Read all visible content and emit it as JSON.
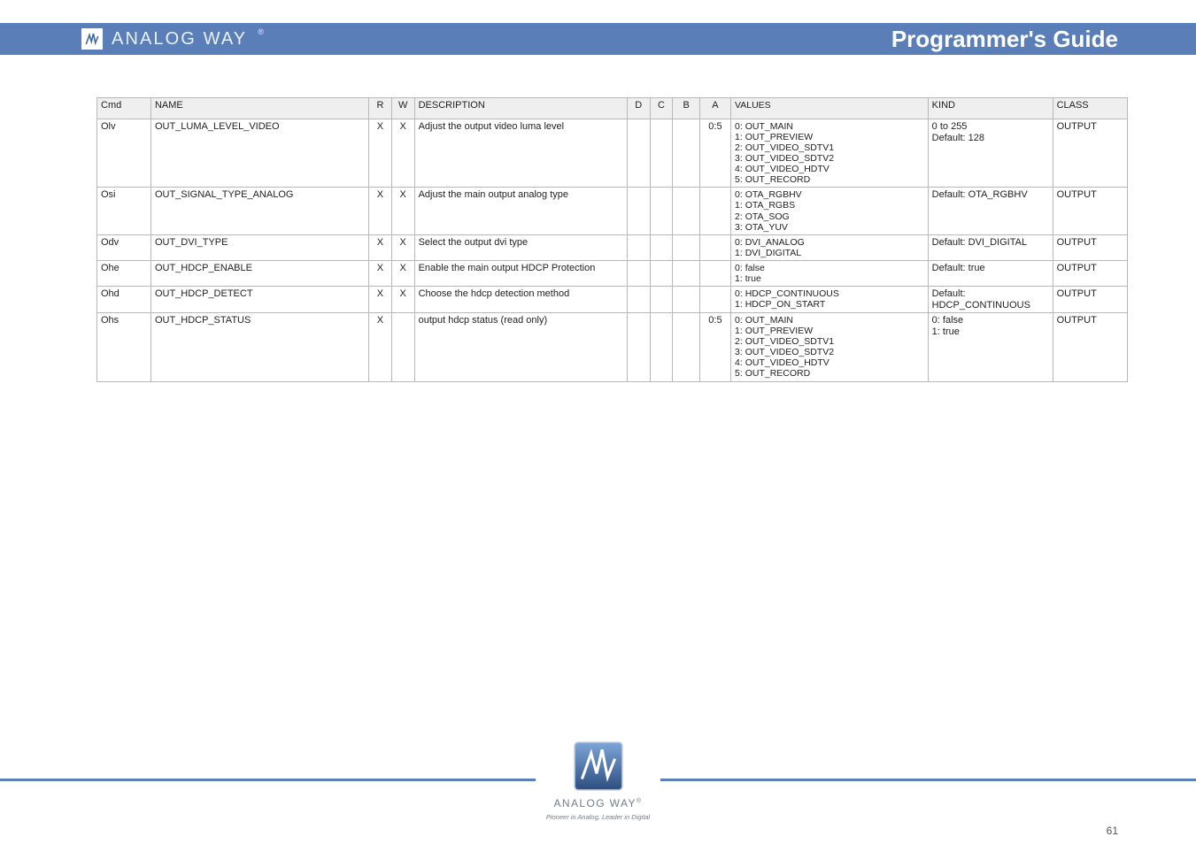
{
  "header": {
    "brand": "ANALOG WAY",
    "reg": "®",
    "title": "Programmer's Guide"
  },
  "table": {
    "headers": [
      "Cmd",
      "NAME",
      "R",
      "W",
      "DESCRIPTION",
      "D",
      "C",
      "B",
      "A",
      "VALUES",
      "KIND",
      "CLASS"
    ],
    "rows": [
      {
        "cmd": "Olv",
        "name": "OUT_LUMA_LEVEL_VIDEO",
        "r": "X",
        "w": "X",
        "desc": "Adjust the output video luma level",
        "d": "",
        "c": "",
        "b": "",
        "a": "0:5",
        "vals": "0: OUT_MAIN\n1: OUT_PREVIEW\n2: OUT_VIDEO_SDTV1\n3: OUT_VIDEO_SDTV2\n4: OUT_VIDEO_HDTV\n5: OUT_RECORD",
        "kind": "0 to 255\nDefault: 128",
        "class": "OUTPUT"
      },
      {
        "cmd": "Osi",
        "name": "OUT_SIGNAL_TYPE_ANALOG",
        "r": "X",
        "w": "X",
        "desc": "Adjust the main output analog type",
        "d": "",
        "c": "",
        "b": "",
        "a": "",
        "vals": "0: OTA_RGBHV\n1: OTA_RGBS\n2: OTA_SOG\n3: OTA_YUV",
        "kind": "Default: OTA_RGBHV",
        "class": "OUTPUT"
      },
      {
        "cmd": "Odv",
        "name": "OUT_DVI_TYPE",
        "r": "X",
        "w": "X",
        "desc": "Select the output dvi type",
        "d": "",
        "c": "",
        "b": "",
        "a": "",
        "vals": "0: DVI_ANALOG\n1: DVI_DIGITAL",
        "kind": "Default: DVI_DIGITAL",
        "class": "OUTPUT"
      },
      {
        "cmd": "Ohe",
        "name": "OUT_HDCP_ENABLE",
        "r": "X",
        "w": "X",
        "desc": "Enable the main output HDCP Protection",
        "d": "",
        "c": "",
        "b": "",
        "a": "",
        "vals": "0: false\n1: true",
        "kind": "Default: true",
        "class": "OUTPUT"
      },
      {
        "cmd": "Ohd",
        "name": "OUT_HDCP_DETECT",
        "r": "X",
        "w": "X",
        "desc": "Choose the hdcp detection method",
        "d": "",
        "c": "",
        "b": "",
        "a": "",
        "vals": "0: HDCP_CONTINUOUS\n1: HDCP_ON_START",
        "kind": "Default: HDCP_CONTINUOUS",
        "class": "OUTPUT"
      },
      {
        "cmd": "Ohs",
        "name": "OUT_HDCP_STATUS",
        "r": "X",
        "w": "",
        "desc": "output hdcp status (read only)",
        "d": "",
        "c": "",
        "b": "",
        "a": "0:5",
        "vals": "0: OUT_MAIN\n1: OUT_PREVIEW\n2: OUT_VIDEO_SDTV1\n3: OUT_VIDEO_SDTV2\n4: OUT_VIDEO_HDTV\n5: OUT_RECORD",
        "kind": "0: false\n1: true",
        "class": "OUTPUT"
      }
    ]
  },
  "footer": {
    "brand": "ANALOG WAY",
    "reg": "®",
    "tag": "Pioneer in Analog, Leader in Digital",
    "page": "61"
  }
}
